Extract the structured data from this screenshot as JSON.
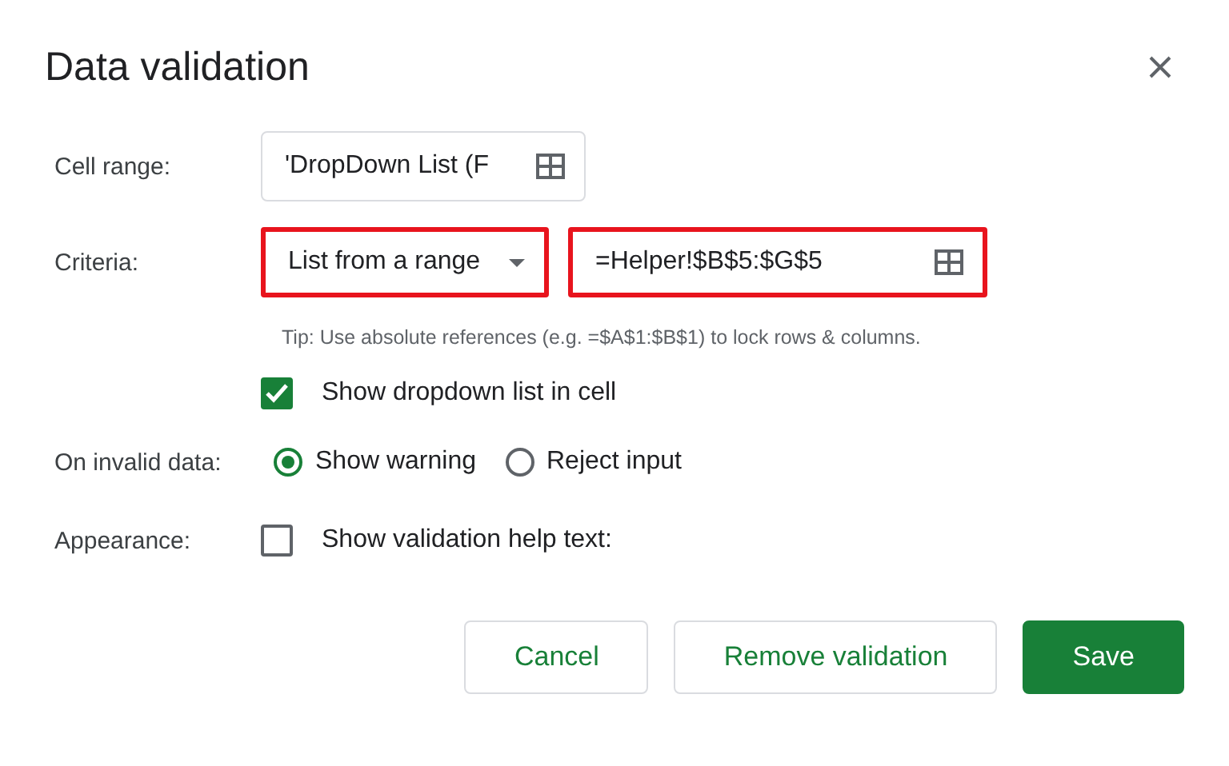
{
  "dialog": {
    "title": "Data validation"
  },
  "cell_range": {
    "label": "Cell range:",
    "value": "'DropDown List (F",
    "highlighted": false
  },
  "criteria": {
    "label": "Criteria:",
    "dropdown": {
      "value": "List from a range",
      "highlighted": true
    },
    "range_field": {
      "value": "=Helper!$B$5:$G$5",
      "highlighted": true
    },
    "tip": "Tip: Use absolute references (e.g. =$A$1:$B$1) to lock rows & columns."
  },
  "show_dropdown": {
    "label": "Show dropdown list in cell",
    "checked": true
  },
  "invalid_data": {
    "label": "On invalid data:",
    "options": [
      {
        "label": "Show warning",
        "selected": true
      },
      {
        "label": "Reject input",
        "selected": false
      }
    ]
  },
  "appearance": {
    "label": "Appearance:",
    "checkbox": {
      "label": "Show validation help text:",
      "checked": false
    }
  },
  "buttons": [
    {
      "label": "Cancel",
      "kind": "plain"
    },
    {
      "label": "Remove validation",
      "kind": "plain"
    },
    {
      "label": "Save",
      "kind": "primary"
    }
  ]
}
